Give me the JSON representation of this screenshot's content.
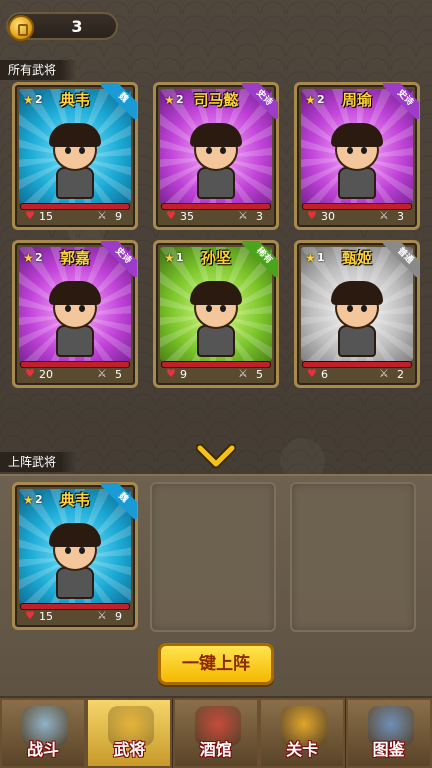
{
  "currency": {
    "count": "3",
    "icon": "gold-coin-icon"
  },
  "all_generals": {
    "label": "所有武将",
    "cards": [
      {
        "name": "典韦",
        "level": "2",
        "badge": "魏",
        "badge_color": "#1a9bd6",
        "hp": "15",
        "atk": "9",
        "bg": "bg-cyan"
      },
      {
        "name": "司马懿",
        "level": "2",
        "badge": "史诗",
        "badge_color": "#9c3cc8",
        "hp": "35",
        "atk": "3",
        "bg": "bg-purple"
      },
      {
        "name": "周瑜",
        "level": "2",
        "badge": "史诗",
        "badge_color": "#9c3cc8",
        "hp": "30",
        "atk": "3",
        "bg": "bg-purple"
      },
      {
        "name": "郭嘉",
        "level": "2",
        "badge": "史诗",
        "badge_color": "#9c3cc8",
        "hp": "20",
        "atk": "5",
        "bg": "bg-purple"
      },
      {
        "name": "孙坚",
        "level": "1",
        "badge": "稀有",
        "badge_color": "#4aa51c",
        "hp": "9",
        "atk": "5",
        "bg": "bg-green"
      },
      {
        "name": "甄姬",
        "level": "1",
        "badge": "普通",
        "badge_color": "#8a8a8a",
        "hp": "6",
        "atk": "2",
        "bg": "bg-silver"
      }
    ]
  },
  "deployed": {
    "label": "上阵武将",
    "card": {
      "name": "典韦",
      "level": "2",
      "badge": "魏",
      "badge_color": "#1a9bd6",
      "hp": "15",
      "atk": "9",
      "bg": "bg-cyan"
    },
    "deploy_button": "一键上阵"
  },
  "nav": [
    {
      "label": "战斗",
      "icon": "crossed-swords-icon",
      "active": false
    },
    {
      "label": "武将",
      "icon": "helmet-icon",
      "active": true
    },
    {
      "label": "酒馆",
      "icon": "tavern-icon",
      "active": false
    },
    {
      "label": "关卡",
      "icon": "flag-icon",
      "active": false
    },
    {
      "label": "图鉴",
      "icon": "scroll-icon",
      "active": false
    }
  ]
}
